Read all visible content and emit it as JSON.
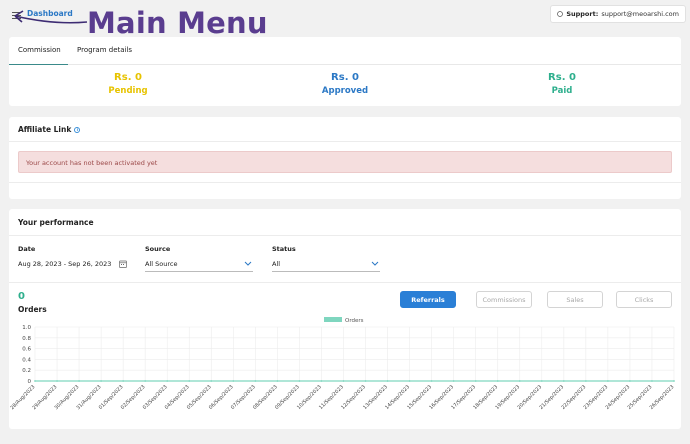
{
  "header": {
    "dashboard_label": "Dashboard",
    "annotation_title": "Main Menu",
    "support_label": "Support:",
    "support_email": "support@meoarshi.com"
  },
  "tabs": [
    {
      "label": "Commission",
      "active": true
    },
    {
      "label": "Program details",
      "active": false
    }
  ],
  "stats": [
    {
      "amount": "Rs. 0",
      "label": "Pending",
      "color": "#e7c300"
    },
    {
      "amount": "Rs. 0",
      "label": "Approved",
      "color": "#2b78c5"
    },
    {
      "amount": "Rs. 0",
      "label": "Paid",
      "color": "#2eaf8d"
    }
  ],
  "affiliate": {
    "title": "Affiliate Link",
    "alert": "Your account has not been activated yet"
  },
  "performance": {
    "title": "Your performance",
    "date_label": "Date",
    "date_value": "Aug 28, 2023 - Sep 26, 2023",
    "source_label": "Source",
    "source_value": "All Source",
    "status_label": "Status",
    "status_value": "All",
    "metric_value": "0",
    "metric_label": "Orders",
    "buttons": [
      {
        "label": "Referrals",
        "active": true
      },
      {
        "label": "Commissions",
        "active": false
      },
      {
        "label": "Sales",
        "active": false
      },
      {
        "label": "Clicks",
        "active": false
      }
    ]
  },
  "chart_data": {
    "type": "line",
    "series": [
      {
        "name": "Orders",
        "color": "#7fd6bf",
        "values": [
          0,
          0,
          0,
          0,
          0,
          0,
          0,
          0,
          0,
          0,
          0,
          0,
          0,
          0,
          0,
          0,
          0,
          0,
          0,
          0,
          0,
          0,
          0,
          0,
          0,
          0,
          0,
          0,
          0,
          0
        ]
      }
    ],
    "x": [
      "28/Aug/2023",
      "29/Aug/2023",
      "30/Aug/2023",
      "31/Aug/2023",
      "01/Sep/2023",
      "02/Sep/2023",
      "03/Sep/2023",
      "04/Sep/2023",
      "05/Sep/2023",
      "06/Sep/2023",
      "07/Sep/2023",
      "08/Sep/2023",
      "09/Sep/2023",
      "10/Sep/2023",
      "11/Sep/2023",
      "12/Sep/2023",
      "13/Sep/2023",
      "14/Sep/2023",
      "15/Sep/2023",
      "16/Sep/2023",
      "17/Sep/2023",
      "18/Sep/2023",
      "19/Sep/2023",
      "20/Sep/2023",
      "21/Sep/2023",
      "22/Sep/2023",
      "23/Sep/2023",
      "24/Sep/2023",
      "25/Sep/2023",
      "26/Sep/2023"
    ],
    "yticks": [
      "1.0",
      "0.8",
      "0.6",
      "0.4",
      "0.2",
      "0"
    ],
    "ylim": [
      0,
      1
    ],
    "grid": true,
    "legend": "top-center"
  }
}
